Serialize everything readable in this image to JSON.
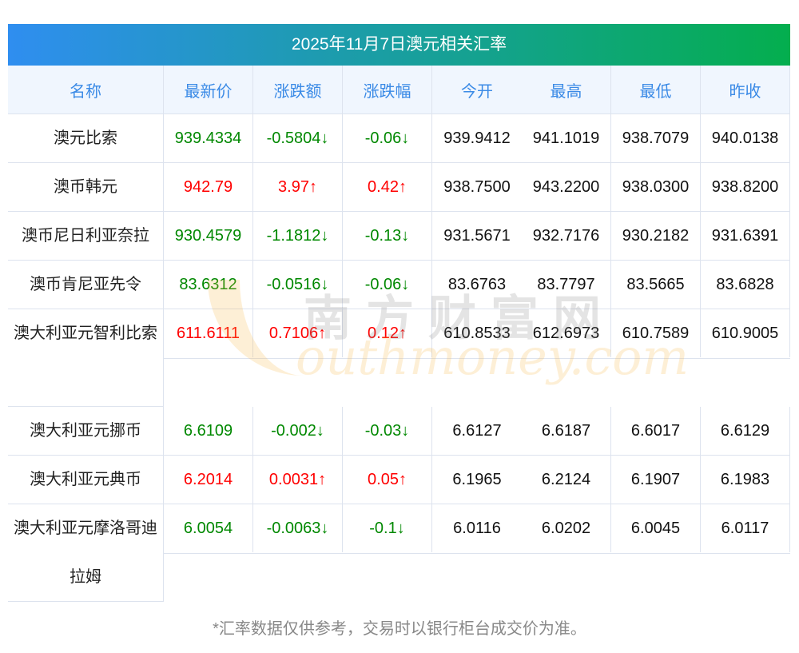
{
  "title": "2025年11月7日澳元相关汇率",
  "headers": [
    "名称",
    "最新价",
    "涨跌额",
    "涨跌幅",
    "今开",
    "最高",
    "最低",
    "昨收"
  ],
  "rows": [
    {
      "name": "澳元比索",
      "trend": "down",
      "latest": "939.4334",
      "change": "-0.5804↓",
      "pct": "-0.06↓",
      "open": "939.9412",
      "high": "941.1019",
      "low": "938.7079",
      "prev": "940.0138"
    },
    {
      "name": "澳币韩元",
      "trend": "up",
      "latest": "942.79",
      "change": "3.97↑",
      "pct": "0.42↑",
      "open": "938.7500",
      "high": "943.2200",
      "low": "938.0300",
      "prev": "938.8200"
    },
    {
      "name": "澳币尼日利亚奈拉",
      "trend": "down",
      "latest": "930.4579",
      "change": "-1.1812↓",
      "pct": "-0.13↓",
      "open": "931.5671",
      "high": "932.7176",
      "low": "930.2182",
      "prev": "931.6391"
    },
    {
      "name": "澳币肯尼亚先令",
      "trend": "down",
      "latest": "83.6312",
      "change": "-0.0516↓",
      "pct": "-0.06↓",
      "open": "83.6763",
      "high": "83.7797",
      "low": "83.5665",
      "prev": "83.6828"
    },
    {
      "name": "澳大利亚元智利比索",
      "trend": "up",
      "latest": "611.6111",
      "change": "0.7106↑",
      "pct": "0.12↑",
      "open": "610.8533",
      "high": "612.6973",
      "low": "610.7589",
      "prev": "610.9005"
    },
    {
      "name": "澳大利亚元挪币",
      "trend": "down",
      "latest": "6.6109",
      "change": "-0.002↓",
      "pct": "-0.03↓",
      "open": "6.6127",
      "high": "6.6187",
      "low": "6.6017",
      "prev": "6.6129"
    },
    {
      "name": "澳大利亚元典币",
      "trend": "up",
      "latest": "6.2014",
      "change": "0.0031↑",
      "pct": "0.05↑",
      "open": "6.1965",
      "high": "6.2124",
      "low": "6.1907",
      "prev": "6.1983"
    },
    {
      "name": "澳大利亚元摩洛哥迪拉姆",
      "trend": "down",
      "latest": "6.0054",
      "change": "-0.0063↓",
      "pct": "-0.1↓",
      "open": "6.0116",
      "high": "6.0202",
      "low": "6.0045",
      "prev": "6.0117"
    }
  ],
  "watermark": {
    "cn": "南方财富网",
    "en": "outhmoney.com"
  },
  "footnote": "*汇率数据仅供参考，交易时以银行柜台成交价为准。",
  "colors": {
    "up": "#ff0000",
    "down": "#008800",
    "header_text": "#3a8ae6"
  }
}
